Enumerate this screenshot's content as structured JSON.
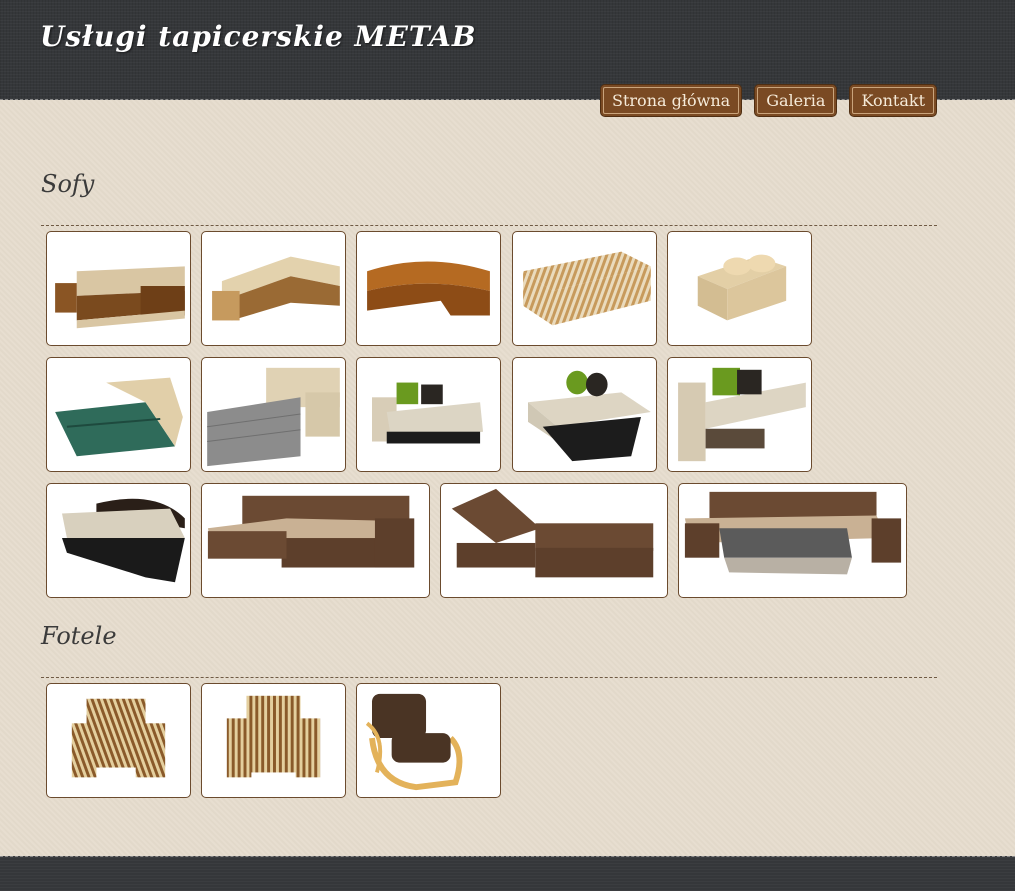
{
  "site": {
    "title": "Usługi tapicerskie METAB"
  },
  "nav": {
    "items": [
      "Strona główna",
      "Galeria",
      "Kontakt"
    ]
  },
  "sections": {
    "sofy": {
      "title": "Sofy"
    },
    "fotele": {
      "title": "Fotele"
    }
  },
  "colors": {
    "header_bg": "#35373a",
    "page_bg": "#e6dccd",
    "nav_button_bg": "#7a4a23",
    "thumb_border": "#6b4b2e",
    "title_text": "#3b3b3b"
  },
  "icons": {
    "sofy": [
      "corner-sofa-icon",
      "corner-sofa-icon",
      "corner-sofa-icon",
      "striped-sofa-icon",
      "sofa-icon",
      "sofa-bed-icon",
      "sofa-bed-icon",
      "sofa-icon",
      "sofa-icon",
      "sofa-bed-icon",
      "sofa-bed-icon",
      "corner-sofa-icon",
      "corner-sofa-bed-icon",
      "corner-sofa-bed-icon"
    ],
    "fotele": [
      "armchair-icon",
      "armchair-icon",
      "armchair-icon"
    ]
  }
}
